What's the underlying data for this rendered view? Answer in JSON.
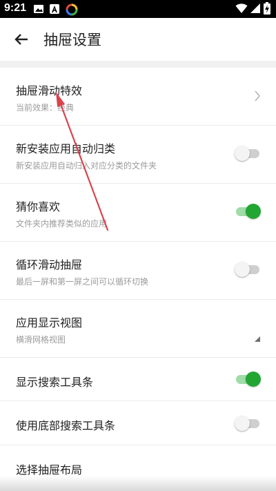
{
  "status_bar": {
    "time": "9:21",
    "left_icons": [
      "image-icon",
      "font-a-icon",
      "app-ring-icon"
    ],
    "right_icons": [
      "wifi-icon",
      "signal-icon",
      "battery-charging-icon"
    ]
  },
  "header": {
    "back_icon": "arrow-back-icon",
    "title": "抽屉设置"
  },
  "settings": [
    {
      "title": "抽屉滑动特效",
      "subtitle": "当前效果：经典",
      "control": "chevron"
    },
    {
      "title": "新安装应用自动归类",
      "subtitle": "新安装应用自动归入对应分类的文件夹",
      "control": "toggle",
      "on": false
    },
    {
      "title": "猜你喜欢",
      "subtitle": "文件夹内推荐类似的应用",
      "control": "toggle",
      "on": true
    },
    {
      "title": "循环滑动抽屉",
      "subtitle": "最后一屏和第一屏之间可以循环切换",
      "control": "toggle",
      "on": false
    },
    {
      "title": "应用显示视图",
      "subtitle": "横滑网格视图",
      "control": "dropdown"
    },
    {
      "title": "显示搜索工具条",
      "control": "toggle",
      "on": true
    },
    {
      "title": "使用底部搜索工具条",
      "control": "toggle",
      "on": false
    },
    {
      "title": "选择抽屉布局",
      "control": "none"
    }
  ],
  "colors": {
    "accent_green": "#21a633",
    "accent_green_track": "#9fdca8",
    "annotation_arrow": "#d9434c"
  }
}
